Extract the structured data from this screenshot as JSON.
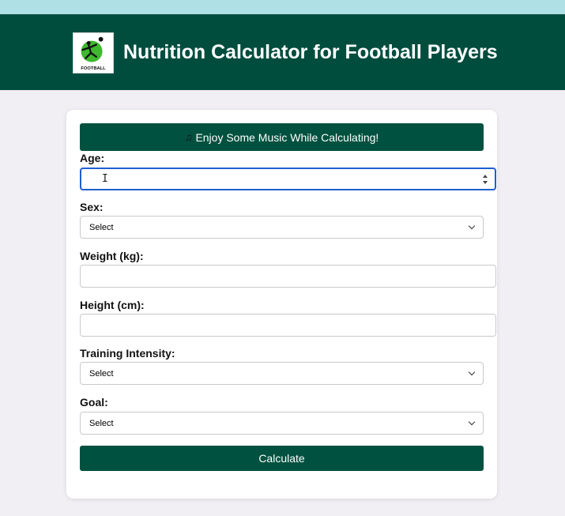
{
  "header": {
    "title": "Nutrition Calculator for Football Players",
    "logo_text": "FOOTBALL",
    "background": "#004d3e"
  },
  "form": {
    "music_button_icon": "♫",
    "music_button_label": "Enjoy Some Music While Calculating!",
    "age": {
      "label": "Age:",
      "value": ""
    },
    "sex": {
      "label": "Sex:",
      "selected": "Select"
    },
    "weight": {
      "label": "Weight (kg):",
      "value": ""
    },
    "height": {
      "label": "Height (cm):",
      "value": ""
    },
    "intensity": {
      "label": "Training Intensity:",
      "selected": "Select"
    },
    "goal": {
      "label": "Goal:",
      "selected": "Select"
    },
    "calculate_label": "Calculate"
  },
  "colors": {
    "accent": "#00513f",
    "focus": "#1f5fd1",
    "top_strip": "#aee0e6"
  }
}
